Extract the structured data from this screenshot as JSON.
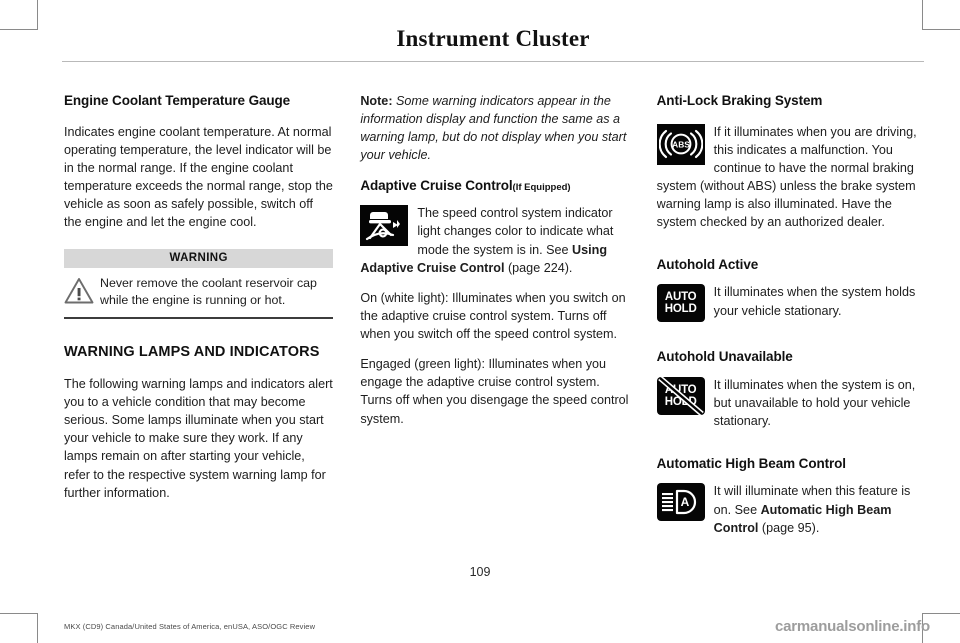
{
  "header": {
    "title": "Instrument Cluster"
  },
  "columns": {
    "left": {
      "heading_coolant": "Engine Coolant Temperature Gauge",
      "para_coolant": "Indicates engine coolant temperature. At normal operating temperature, the level indicator will be in the normal range. If the engine coolant temperature exceeds the normal range, stop the vehicle as soon as safely possible, switch off the engine and let the engine cool.",
      "warning": {
        "label": "WARNING",
        "icon": "warning-triangle-icon",
        "text": "Never remove the coolant reservoir cap while the engine is running or hot."
      },
      "heading_lamps": "WARNING LAMPS AND INDICATORS",
      "para_lamps": "The following warning lamps and indicators alert you to a vehicle condition that may become serious. Some lamps illuminate when you start your vehicle to make sure they work. If any lamps remain on after starting your vehicle, refer to the respective system warning lamp for further information."
    },
    "middle": {
      "note_label": "Note:",
      "note_text": " Some warning indicators appear in the information display and function the same as a warning lamp, but do not display when you start your vehicle.",
      "heading_acc": "Adaptive Cruise Control",
      "heading_acc_sub": "(If Equipped)",
      "acc_icon": "adaptive-cruise-control-icon",
      "acc_text_1": "The speed control system indicator light changes color to indicate what mode the system is in.  See ",
      "acc_text_bold": "Using Adaptive Cruise Control",
      "acc_text_2": " (page 224).",
      "para_on": "On (white light): Illuminates when you switch on the adaptive cruise control system. Turns off when you switch off the speed control system.",
      "para_engaged": "Engaged (green light): Illuminates when you engage the adaptive cruise control system. Turns off when you disengage the speed control system."
    },
    "right": {
      "heading_abs": "Anti-Lock Braking System",
      "abs_icon": "abs-warning-icon",
      "abs_text": "If it illuminates when you are driving, this indicates a malfunction. You continue to have the normal braking system (without ABS) unless the brake system warning lamp is also illuminated. Have the system checked by an authorized dealer.",
      "heading_autohold_active": "Autohold Active",
      "autohold_active_icon": "autohold-active-icon",
      "autohold_active_line1": "AUTO",
      "autohold_active_line2": "HOLD",
      "autohold_active_text": "It illuminates when the system holds your vehicle stationary.",
      "heading_autohold_unavailable": "Autohold Unavailable",
      "autohold_unavailable_icon": "autohold-unavailable-icon",
      "autohold_unavailable_line1": "AUTO",
      "autohold_unavailable_line2": "HOLD",
      "autohold_unavailable_text": "It illuminates when the system is on, but unavailable to hold your vehicle stationary.",
      "heading_high_beam": "Automatic High Beam Control",
      "high_beam_icon": "automatic-high-beam-icon",
      "high_beam_letter": "A",
      "high_beam_text_1": "It will illuminate when this feature is on.  See ",
      "high_beam_text_bold": "Automatic High Beam Control",
      "high_beam_text_2": " (page 95)."
    }
  },
  "footer": {
    "page_number": "109",
    "note": "MKX (CD9) Canada/United States of America, enUSA, ASO/OGC Review",
    "watermark": "carmanualsonline.info"
  },
  "colors": {
    "icon_background": "#050505",
    "warning_bar": "#d7d7d7",
    "rule": "#b9b9b9"
  }
}
